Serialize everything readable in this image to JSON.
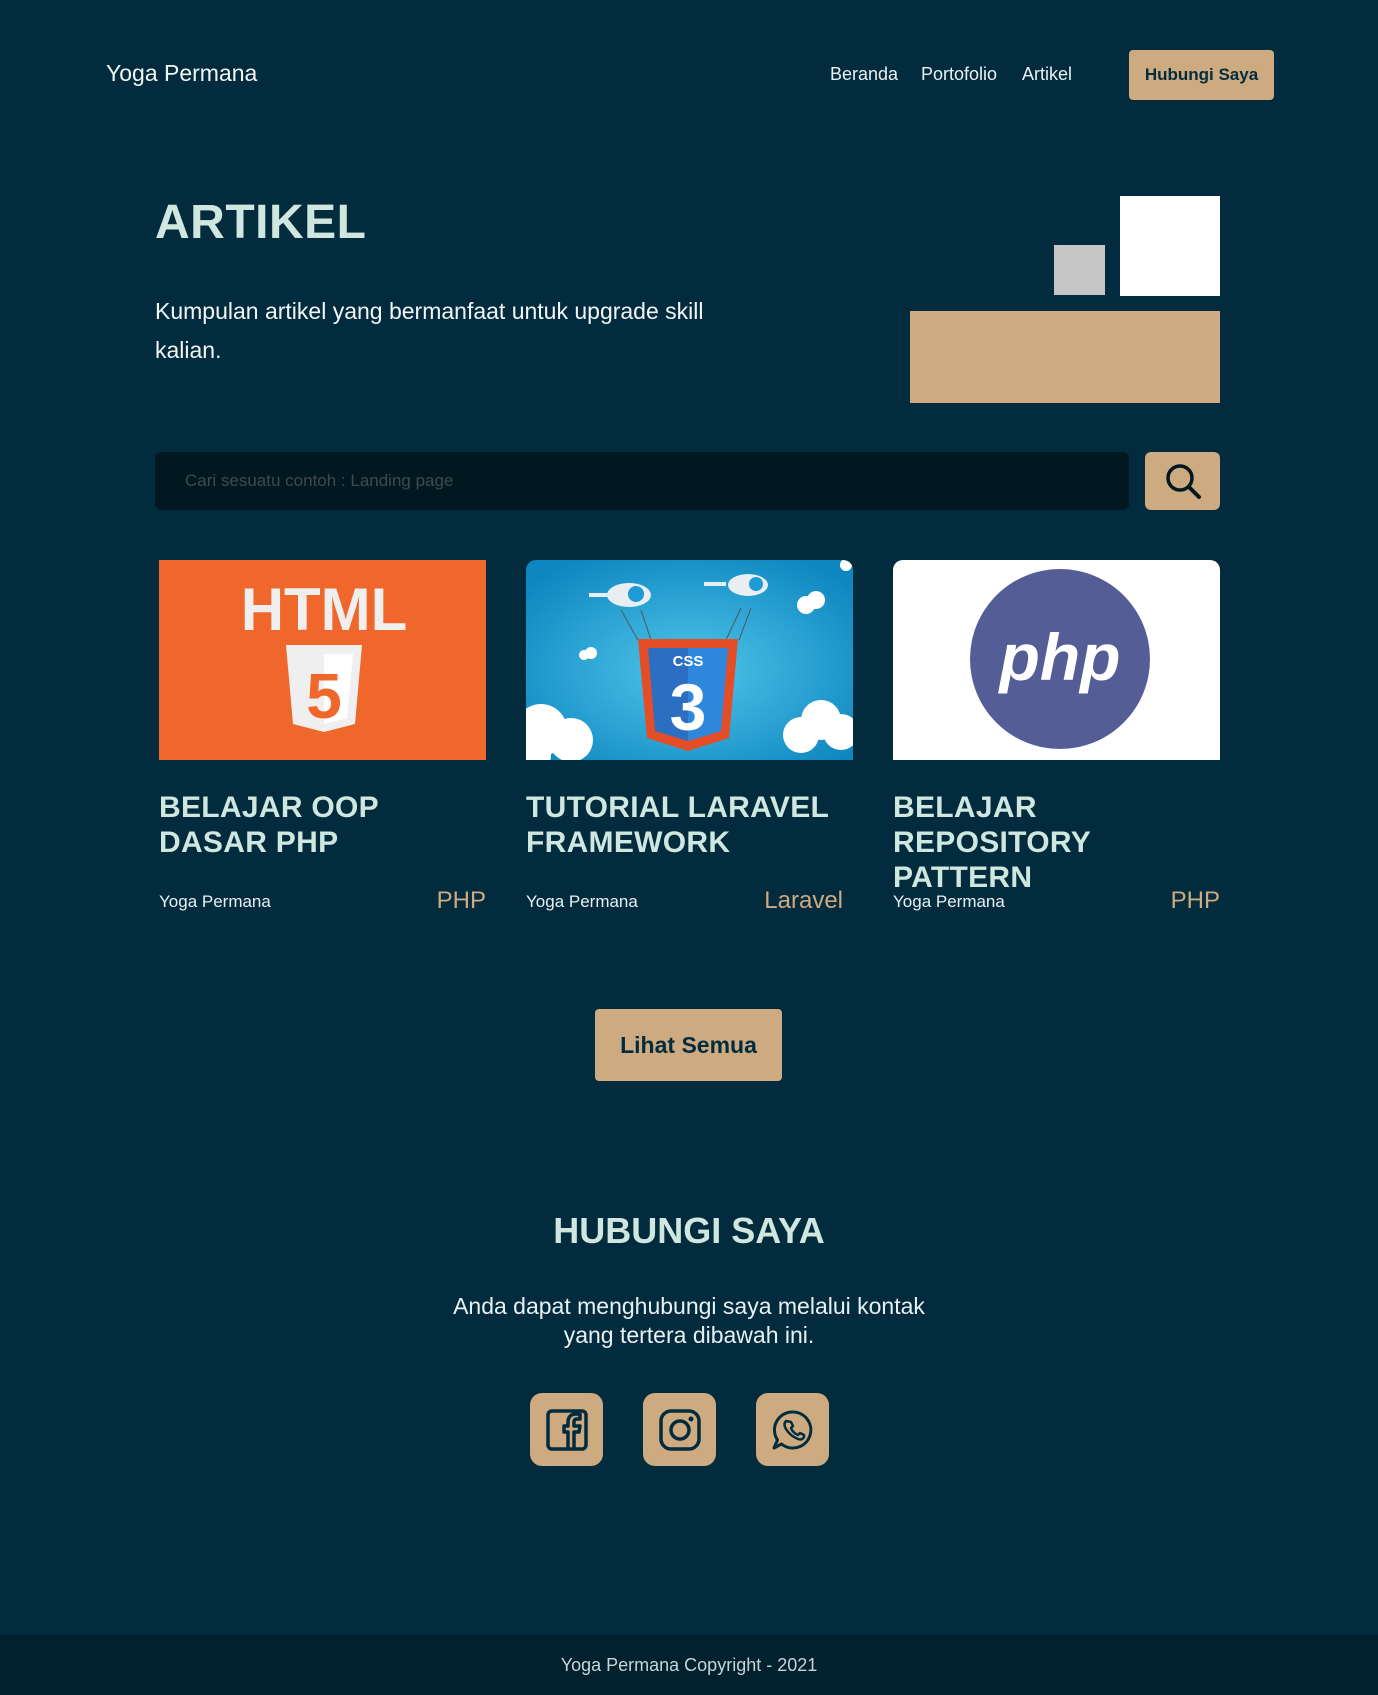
{
  "nav": {
    "brand": "Yoga Permana",
    "links": [
      "Beranda",
      "Portofolio",
      "Artikel"
    ],
    "cta": "Hubungi Saya"
  },
  "hero": {
    "title": "ARTIKEL",
    "subtitle": "Kumpulan artikel yang bermanfaat untuk upgrade skill kalian."
  },
  "search": {
    "placeholder": "Cari sesuatu contoh  : Landing page",
    "icon": "search-icon"
  },
  "articles": [
    {
      "title": "BELAJAR OOP DASAR PHP",
      "author": "Yoga Permana",
      "tag": "PHP",
      "image": "html5-logo",
      "image_text": "HTML",
      "image_number": "5"
    },
    {
      "title": "TUTORIAL LARAVEL FRAMEWORK",
      "author": "Yoga Permana",
      "tag": "Laravel",
      "image": "css3-logo",
      "image_text": "CSS",
      "image_number": "3"
    },
    {
      "title": "BELAJAR REPOSITORY PATTERN",
      "author": "Yoga Permana",
      "tag": "PHP",
      "image": "php-logo",
      "image_text": "php"
    }
  ],
  "see_all": "Lihat Semua",
  "contact": {
    "title": "HUBUNGI SAYA",
    "subtitle": "Anda dapat menghubungi saya melalui kontak yang tertera dibawah ini.",
    "socials": [
      "facebook-icon",
      "instagram-icon",
      "whatsapp-icon"
    ]
  },
  "footer": "Yoga Permana Copyright - 2021",
  "colors": {
    "background": "#022c3d",
    "accent": "#cdaa80",
    "heading": "#cfe7df",
    "footer_bg": "#01212e"
  }
}
